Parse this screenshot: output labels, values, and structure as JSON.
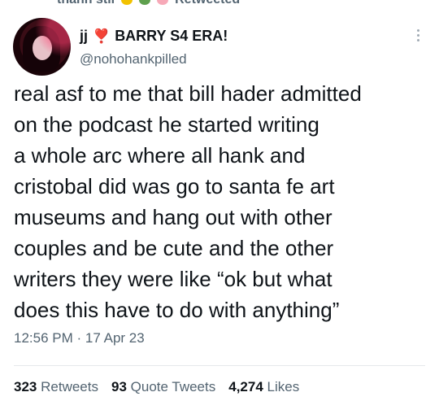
{
  "context": {
    "text_left": "thanh stil",
    "text_right": "Retweeted"
  },
  "user": {
    "display_name_prefix": "jj",
    "heart_emoji": "❣️",
    "display_name_suffix": "BARRY S4 ERA!",
    "handle": "@nohohankpilled",
    "avatar_icon": "profile-photo"
  },
  "tweet": {
    "lines": [
      "real asf to me that bill hader admitted",
      "on the podcast he started writing",
      "a whole arc where all hank and",
      "cristobal did was go to santa fe art",
      "museums and hang out with other",
      "couples and be cute and the other",
      "writers they were like “ok but what",
      "does this have to do with anything”"
    ],
    "time": "12:56 PM",
    "separator": "·",
    "date": "17 Apr 23"
  },
  "stats": {
    "retweets_count": "323",
    "retweets_label": "Retweets",
    "quotes_count": "93",
    "quotes_label": "Quote Tweets",
    "likes_count": "4,274",
    "likes_label": "Likes"
  },
  "colors": {
    "text": "#0f1419",
    "secondary": "#536471",
    "heart": "#e0245e",
    "divider": "#e5e8eb"
  }
}
